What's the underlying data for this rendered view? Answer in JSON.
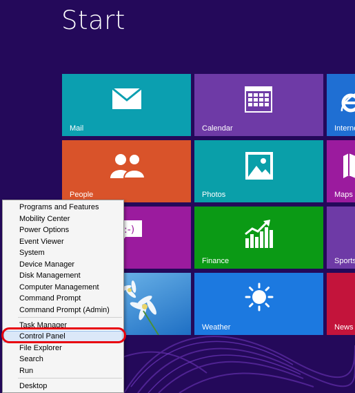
{
  "screen": {
    "title": "Start",
    "colors": {
      "background": "#24095a",
      "highlight_ring": "#e8000e",
      "menu_highlight": "#dbe8f8"
    }
  },
  "tiles": {
    "mail": {
      "label": "Mail",
      "icon": "envelope-icon",
      "color": "#0b9fb0"
    },
    "calendar": {
      "label": "Calendar",
      "icon": "calendar-icon",
      "color": "#6e3aa6"
    },
    "internet": {
      "label": "Interne",
      "icon": "internet-explorer-icon",
      "color": "#1f6fd3"
    },
    "people": {
      "label": "People",
      "icon": "people-icon",
      "color": "#d9532a"
    },
    "photos": {
      "label": "Photos",
      "icon": "photo-icon",
      "color": "#0a9fa9"
    },
    "maps": {
      "label": "Maps",
      "icon": "map-icon",
      "color": "#9b1b9e"
    },
    "messaging": {
      "label": "",
      "icon": "messaging-icon",
      "color": "#9b1b9e"
    },
    "finance": {
      "label": "Finance",
      "icon": "finance-chart-icon",
      "color": "#0b9a15"
    },
    "sports": {
      "label": "Sports",
      "icon": "",
      "color": "#6e3aa6"
    },
    "desktop": {
      "label": "",
      "icon": "",
      "color": "#3a8fd6"
    },
    "weather": {
      "label": "Weather",
      "icon": "sun-icon",
      "color": "#1c79e0"
    },
    "news": {
      "label": "News",
      "icon": "",
      "color": "#c3143b"
    }
  },
  "context_menu": {
    "items": [
      {
        "key": "programs_and_features",
        "label": "Programs and Features"
      },
      {
        "key": "mobility_center",
        "label": "Mobility Center"
      },
      {
        "key": "power_options",
        "label": "Power Options"
      },
      {
        "key": "event_viewer",
        "label": "Event Viewer"
      },
      {
        "key": "system",
        "label": "System"
      },
      {
        "key": "device_manager",
        "label": "Device Manager"
      },
      {
        "key": "disk_management",
        "label": "Disk Management"
      },
      {
        "key": "computer_management",
        "label": "Computer Management"
      },
      {
        "key": "command_prompt",
        "label": "Command Prompt"
      },
      {
        "key": "command_prompt_admin",
        "label": "Command Prompt (Admin)"
      },
      {
        "key": "task_manager",
        "label": "Task Manager"
      },
      {
        "key": "control_panel",
        "label": "Control Panel",
        "highlighted": true
      },
      {
        "key": "file_explorer",
        "label": "File Explorer"
      },
      {
        "key": "search",
        "label": "Search"
      },
      {
        "key": "run",
        "label": "Run"
      },
      {
        "key": "desktop",
        "label": "Desktop"
      }
    ]
  }
}
